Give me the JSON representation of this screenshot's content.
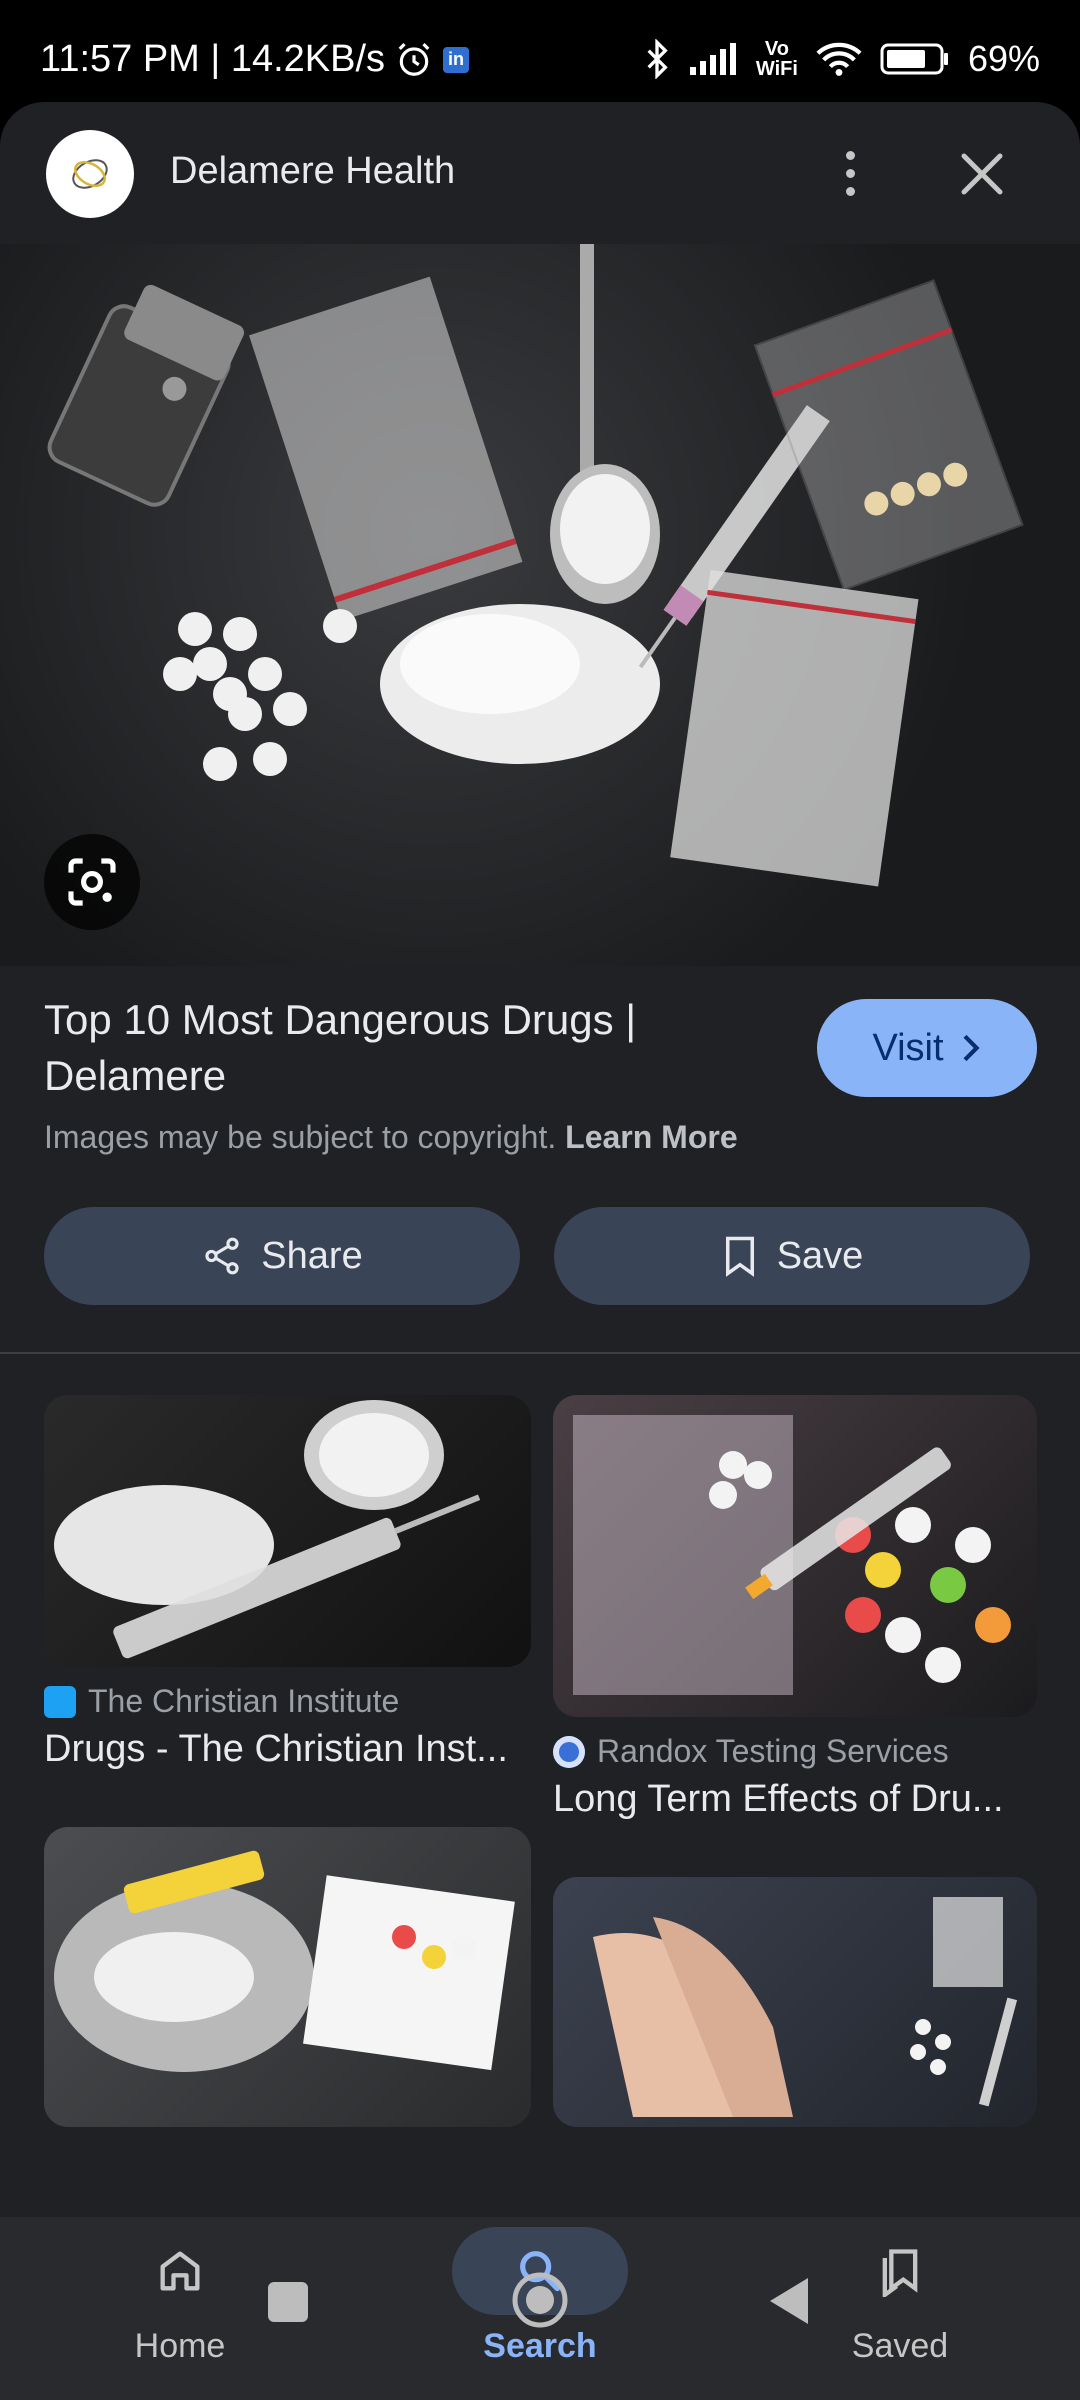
{
  "status_bar": {
    "time_speed": "11:57 PM | 14.2KB/s",
    "linkedin_badge": "in",
    "vowifi_top": "Vo",
    "vowifi_bottom": "WiFi",
    "battery": "69%"
  },
  "header": {
    "site_name": "Delamere Health"
  },
  "result": {
    "title": "Top 10 Most Dangerous Drugs | Delamere",
    "visit_label": "Visit",
    "copyright_text": "Images may be subject to copyright.",
    "learn_more": "Learn More"
  },
  "actions": {
    "share_label": "Share",
    "save_label": "Save"
  },
  "related": [
    {
      "source": "The Christian Institute",
      "title": "Drugs - The Christian Inst...",
      "favicon_color": "#1da1f2"
    },
    {
      "source": "Randox Testing Services",
      "title": "Long Term Effects of Dru...",
      "favicon_color": "#3b6fd8"
    },
    {
      "source": "",
      "title": ""
    },
    {
      "source": "",
      "title": ""
    }
  ],
  "bottom_nav": {
    "items": [
      {
        "label": "Home",
        "icon": "home-icon"
      },
      {
        "label": "Search",
        "icon": "search-icon",
        "active": true
      },
      {
        "label": "Saved",
        "icon": "saved-icon"
      }
    ]
  },
  "colors": {
    "accent": "#8ab4f8",
    "surface": "#202124",
    "button": "#394457"
  }
}
